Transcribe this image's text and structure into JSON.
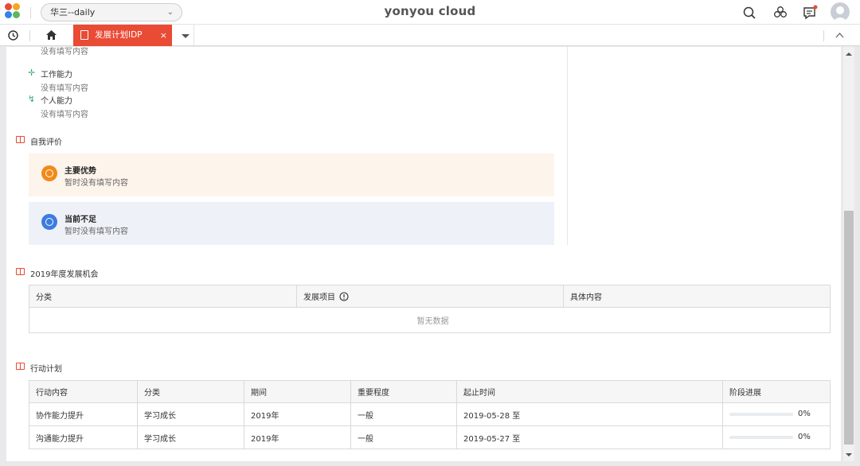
{
  "topbar": {
    "org_name": "华三--daily",
    "brand": "yonyou cloud",
    "icons": [
      "search-icon",
      "apps-icon",
      "message-icon",
      "user-avatar"
    ]
  },
  "tabs": {
    "active_label": "发展计划IDP",
    "close": "×"
  },
  "abilities": [
    {
      "title": "",
      "desc": "没有填写内容"
    },
    {
      "title": "工作能力",
      "desc": "没有填写内容"
    },
    {
      "title": "个人能力",
      "desc": "没有填写内容"
    }
  ],
  "self_eval": {
    "title": "自我评价",
    "strength": {
      "title": "主要优势",
      "desc": "暂时没有填写内容",
      "color": "#f28a1a",
      "bg": "#fdf4ec"
    },
    "weakness": {
      "title": "当前不足",
      "desc": "暂时没有填写内容",
      "color": "#3d7be0",
      "bg": "#eef2f8"
    }
  },
  "opportunities": {
    "title": "2019年度发展机会",
    "headers": [
      "分类",
      "发展项目",
      "具体内容"
    ],
    "empty_text": "暂无数据"
  },
  "action_plan": {
    "title": "行动计划",
    "headers": [
      "行动内容",
      "分类",
      "期间",
      "重要程度",
      "起止时间",
      "阶段进展"
    ],
    "rows": [
      {
        "content": "协作能力提升",
        "category": "学习成长",
        "period": "2019年",
        "importance": "一般",
        "dates": "2019-05-28 至",
        "progress": "0%"
      },
      {
        "content": "沟通能力提升",
        "category": "学习成长",
        "period": "2019年",
        "importance": "一般",
        "dates": "2019-05-27 至",
        "progress": "0%"
      }
    ]
  }
}
